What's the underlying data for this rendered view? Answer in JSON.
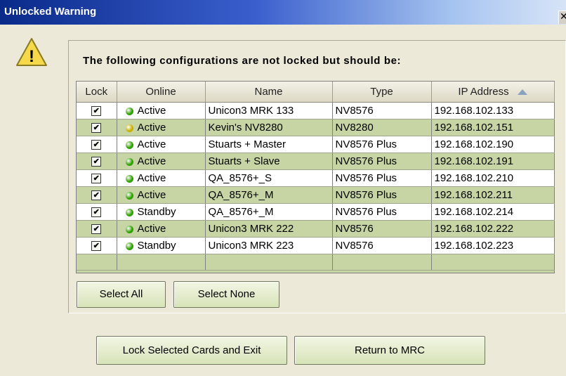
{
  "window": {
    "title": "Unlocked Warning",
    "close_glyph": "✕"
  },
  "icon": {
    "name": "warning-icon",
    "glyph": "!"
  },
  "group": {
    "title": "The following configurations are not locked but should be:"
  },
  "table": {
    "headers": [
      "Lock",
      "Online",
      "Name",
      "Type",
      "IP Address"
    ],
    "sorted_column": "IP Address",
    "sort_direction": "ascending",
    "rows": [
      {
        "locked": true,
        "online_color": "#2fa000",
        "online": "Active",
        "name": "Unicon3 MRK 133",
        "type": "NV8576",
        "ip": "192.168.102.133"
      },
      {
        "locked": true,
        "online_color": "#c9b000",
        "online": "Active",
        "name": "Kevin's NV8280",
        "type": "NV8280",
        "ip": "192.168.102.151"
      },
      {
        "locked": true,
        "online_color": "#2fa000",
        "online": "Active",
        "name": "Stuarts + Master",
        "type": "NV8576 Plus",
        "ip": "192.168.102.190"
      },
      {
        "locked": true,
        "online_color": "#2fa000",
        "online": "Active",
        "name": "Stuarts + Slave",
        "type": "NV8576 Plus",
        "ip": "192.168.102.191"
      },
      {
        "locked": true,
        "online_color": "#2fa000",
        "online": "Active",
        "name": "QA_8576+_S",
        "type": "NV8576 Plus",
        "ip": "192.168.102.210"
      },
      {
        "locked": true,
        "online_color": "#2fa000",
        "online": "Active",
        "name": "QA_8576+_M",
        "type": "NV8576 Plus",
        "ip": "192.168.102.211"
      },
      {
        "locked": true,
        "online_color": "#2fa000",
        "online": "Standby",
        "name": "QA_8576+_M",
        "type": "NV8576 Plus",
        "ip": "192.168.102.214"
      },
      {
        "locked": true,
        "online_color": "#2fa000",
        "online": "Active",
        "name": "Unicon3 MRK 222",
        "type": "NV8576",
        "ip": "192.168.102.222"
      },
      {
        "locked": true,
        "online_color": "#2fa000",
        "online": "Standby",
        "name": "Unicon3 MRK 223",
        "type": "NV8576",
        "ip": "192.168.102.223"
      }
    ]
  },
  "buttons": {
    "select_all": "Select All",
    "select_none": "Select None",
    "lock_exit": "Lock Selected Cards and Exit",
    "return": "Return to MRC"
  },
  "colors": {
    "row_alt": "#c6d5a3",
    "row": "#ffffff",
    "titlebar_start": "#0a2a8a",
    "warning_fill": "#f5d94a"
  }
}
